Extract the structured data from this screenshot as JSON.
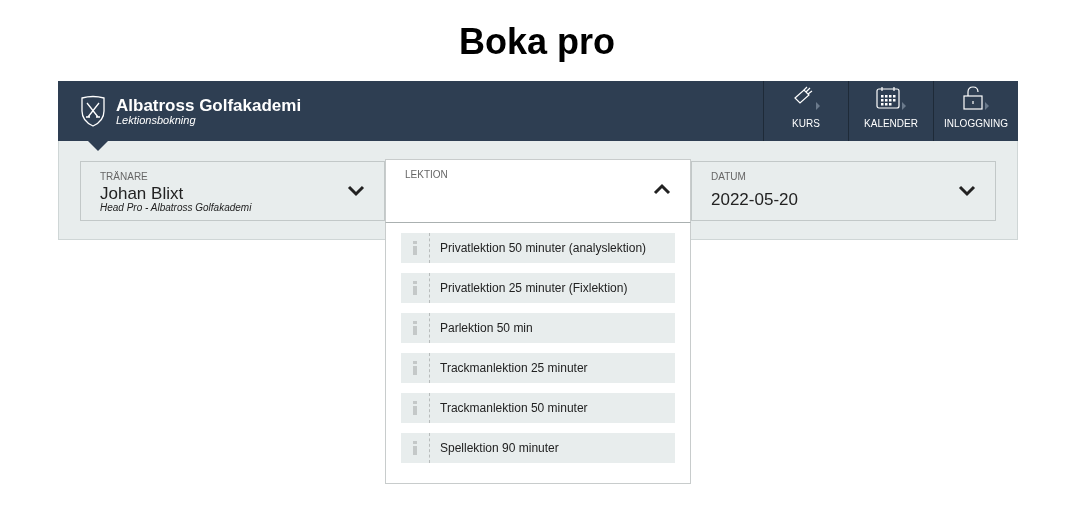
{
  "page_title": "Boka pro",
  "header": {
    "brand": "Albatross Golfakademi",
    "subtitle": "Lektionsbokning"
  },
  "nav": [
    {
      "kind": "bag",
      "label": "KURS"
    },
    {
      "kind": "calendar",
      "label": "KALENDER"
    },
    {
      "kind": "lock",
      "label": "INLOGGNING"
    }
  ],
  "fields": [
    {
      "label": "TRÄNARE",
      "value": "Johan Blixt",
      "detail": "Head Pro - Albatross Golfakademi",
      "expanded": false
    },
    {
      "label": "LEKTION",
      "expanded": true,
      "options": [
        "Privatlektion 50 minuter (analyslektion)",
        "Privatlektion 25 minuter (Fixlektion)",
        "Parlektion 50 min",
        "Trackmanlektion 25 minuter",
        "Trackmanlektion 50 minuter",
        "Spellektion 90 minuter"
      ]
    },
    {
      "label": "DATUM",
      "value": "2022-05-20",
      "expanded": false
    }
  ]
}
